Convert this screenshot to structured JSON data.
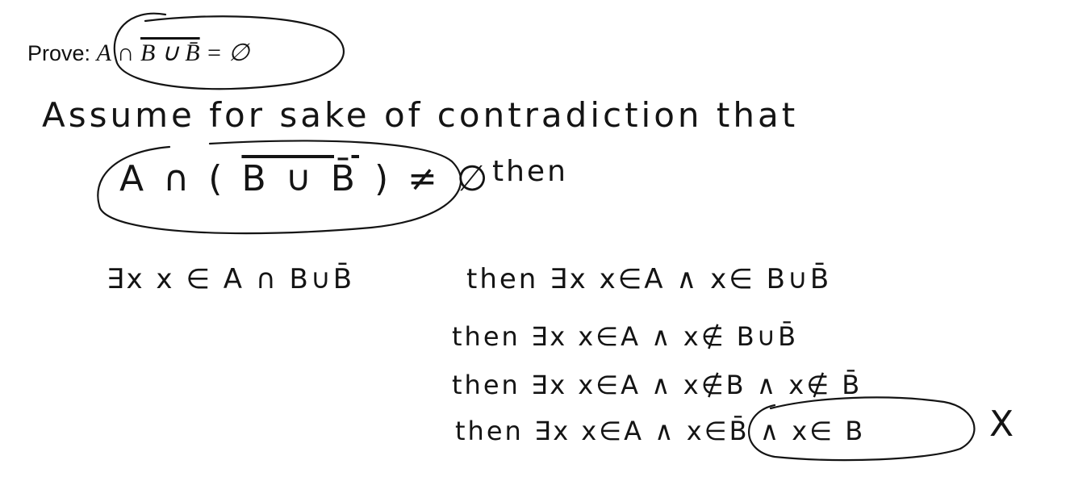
{
  "header": {
    "prove_label": "Prove:",
    "statement_prefix": "A ∩ ",
    "statement_overlined": "B ∪ B̄",
    "statement_suffix": " = ∅"
  },
  "proof": {
    "assume_line": "Assume  for  sake  of  contradiction  that",
    "negated_prefix": "A ∩ ( ",
    "negated_overlined": "B ∪ B̄",
    "negated_suffix": " ) ≠ ∅",
    "then_0": "then",
    "step_1": "∃x   x ∈ A ∩ B∪B̄",
    "step_2": "then   ∃x   x∈A ∧ x∈ B∪B̄",
    "step_3": "then   ∃x   x∈A ∧  x∉ B∪B̄",
    "step_4": "then   ∃x   x∈A ∧  x∉B ∧ x∉ B̄",
    "step_5": "then   ∃x   x∈A ∧  x∈B̄ ∧ x∈ B",
    "contradiction_mark": "X"
  }
}
